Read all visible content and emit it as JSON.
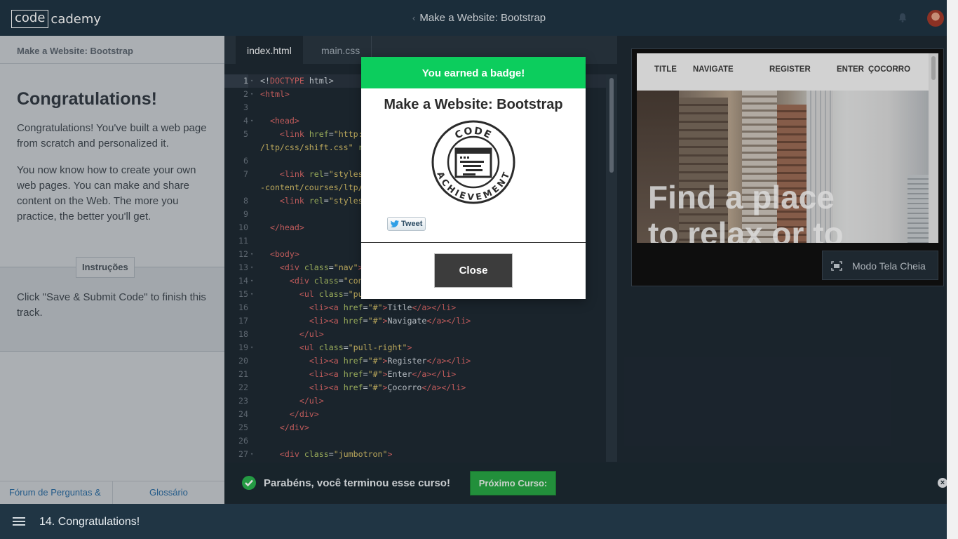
{
  "header": {
    "logo_code": "code",
    "logo_rest": "cademy",
    "course_title": "Make a Website: Bootstrap",
    "back_chevron": "‹"
  },
  "left": {
    "header": "Make a Website: Bootstrap",
    "title": "Congratulations!",
    "paragraphs": [
      "Congratulations! You've built a web page from scratch and personalized it.",
      "You now know how to create your own web pages. You can make and share content on the Web. The more you practice, the better you'll get."
    ],
    "instructions_tab": "Instruções",
    "instructions": "Click \"Save & Submit Code\" to finish this track.",
    "footer_links": [
      "Fórum de Perguntas &",
      "Glossário"
    ]
  },
  "editor": {
    "tabs": [
      "index.html",
      "main.css"
    ],
    "line_numbers": [
      "1",
      "2",
      "3",
      "4",
      "5",
      "",
      "6",
      "7",
      "",
      "8",
      "9",
      "10",
      "11",
      "12",
      "13",
      "14",
      "15",
      "16",
      "17",
      "18",
      "19",
      "20",
      "21",
      "22",
      "23",
      "24",
      "25",
      "26",
      "27"
    ]
  },
  "preview": {
    "nav": [
      "TITLE",
      "NAVIGATE",
      "REGISTER",
      "ENTER",
      "ÇOCORRO"
    ],
    "jumbo_line1": "Find a place",
    "jumbo_line2": "to relax or to",
    "fullscreen_label": "Modo Tela Cheia"
  },
  "modal": {
    "header": "You earned a badge!",
    "title": "Make a Website: Bootstrap",
    "badge_top": "CODE",
    "badge_bottom": "ACHIEVEMENT",
    "tweet_label": "Tweet",
    "close_label": "Close"
  },
  "banner": {
    "message": "Parabéns, você terminou esse curso!",
    "next_label": "Próximo Curso:"
  },
  "bottombar": {
    "lesson": "14. Congratulations!"
  },
  "colors": {
    "topbar": "#203544",
    "badge_header": "#0ccd5d",
    "next_button": "#28a745",
    "editor_bg": "#1f2a34"
  }
}
